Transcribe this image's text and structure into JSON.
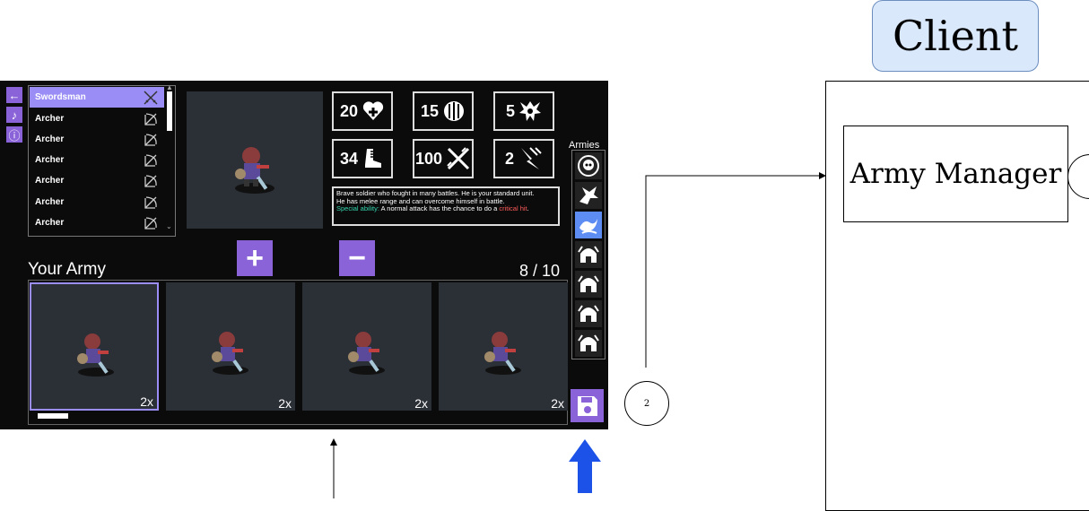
{
  "sidebar_buttons": [
    {
      "icon": "back-arrow-icon",
      "glyph": "←"
    },
    {
      "icon": "music-note-icon",
      "glyph": "♪"
    },
    {
      "icon": "info-icon",
      "glyph": "ⓘ"
    }
  ],
  "unit_list": [
    {
      "name": "Swordsman",
      "icon": "crossed-swords-icon",
      "selected": true
    },
    {
      "name": "Archer",
      "icon": "bow-icon",
      "selected": false
    },
    {
      "name": "Archer",
      "icon": "bow-icon",
      "selected": false
    },
    {
      "name": "Archer",
      "icon": "bow-icon",
      "selected": false
    },
    {
      "name": "Archer",
      "icon": "bow-icon",
      "selected": false
    },
    {
      "name": "Archer",
      "icon": "bow-icon",
      "selected": false
    },
    {
      "name": "Archer",
      "icon": "bow-icon",
      "selected": false
    }
  ],
  "stats": [
    {
      "value": "20",
      "icon": "heart-plus-icon"
    },
    {
      "value": "15",
      "icon": "shield-icon"
    },
    {
      "value": "5",
      "icon": "star-burst-icon"
    },
    {
      "value": "34",
      "icon": "boot-icon"
    },
    {
      "value": "100",
      "icon": "swords-icon"
    },
    {
      "value": "2",
      "icon": "lightning-icon"
    }
  ],
  "description": {
    "line1": "Brave soldier who fought in many battles. He is your standard unit.",
    "line2": "He has melee range and can overcome himself in battle.",
    "special_label": "Special ability:",
    "special_text": " A normal attack has the chance to do a ",
    "special_crit": "critical hit",
    "special_end": "."
  },
  "buttons": {
    "add": "+",
    "remove": "−"
  },
  "army": {
    "title": "Your Army",
    "count": "8 / 10",
    "slots": [
      {
        "count": "2x",
        "selected": true
      },
      {
        "count": "2x",
        "selected": false
      },
      {
        "count": "2x",
        "selected": false
      },
      {
        "count": "2x",
        "selected": false
      }
    ]
  },
  "armies": {
    "label": "Armies",
    "icons": [
      "skull-emblem-icon",
      "dragon-emblem-icon",
      "wave-emblem-icon",
      "helmet-icon",
      "helmet-icon",
      "helmet-icon",
      "helmet-icon"
    ],
    "selected_index": 2
  },
  "save_icon": "save-disk-icon",
  "diagram": {
    "client_label": "Client",
    "army_manager_label": "Army Manager",
    "circle_label": "2"
  },
  "colors": {
    "accent": "#8b63d9",
    "selected_row": "#9a8ef6",
    "army_selected": "#5d8df2",
    "arrow_blue": "#1c52e8",
    "client_fill": "#dae8fc"
  }
}
